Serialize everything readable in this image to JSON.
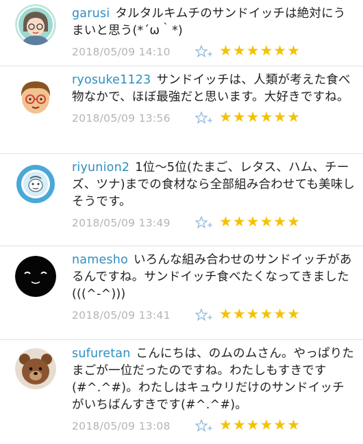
{
  "comments": [
    {
      "username": "garusi",
      "text": "タルタルキムチのサンドイッチは絶対にうまいと思う(*´ω｀*)",
      "timestamp": "2018/05/09 14:10",
      "stars": "★★★★★★",
      "avatar_icon": "avatar-illustrated-face-icon"
    },
    {
      "username": "ryosuke1123",
      "text": "サンドイッチは、人類が考えた食べ物なかで、ほぼ最強だと思います。大好きですね。",
      "timestamp": "2018/05/09 13:56",
      "stars": "★★★★★★",
      "avatar_icon": "avatar-boy-glasses-icon"
    },
    {
      "username": "riyunion2",
      "text": "1位〜5位(たまご、レタス、ハム、チーズ、ツナ)までの食材なら全部組み合わせても美味しそうです。",
      "timestamp": "2018/05/09 13:49",
      "stars": "★★★★★★",
      "avatar_icon": "avatar-badge-emblem-icon"
    },
    {
      "username": "namesho",
      "text": "いろんな組み合わせのサンドイッチがあるんですね。サンドイッチ食べたくなってきました(((^-^)))",
      "timestamp": "2018/05/09 13:41",
      "stars": "★★★★★★",
      "avatar_icon": "avatar-black-smiley-icon"
    },
    {
      "username": "sufuretan",
      "text": "こんにちは、のムのムさん。やっぱりたまごが一位だったのですね。わたしもすきです(#^.^#)。わたしはキュウリだけのサンドイッチがいちばんすきです(#^.^#)。",
      "timestamp": "2018/05/09 13:08",
      "stars": "★★★★★★",
      "avatar_icon": "avatar-teddy-bear-icon"
    }
  ],
  "colors": {
    "username": "#2e8fbf",
    "timestamp": "#b4b4b4",
    "star": "#f4c200",
    "fav_icon": "#8fb8da",
    "divider": "#e2e2e2"
  },
  "fav_icon_name": "star-plus-icon"
}
